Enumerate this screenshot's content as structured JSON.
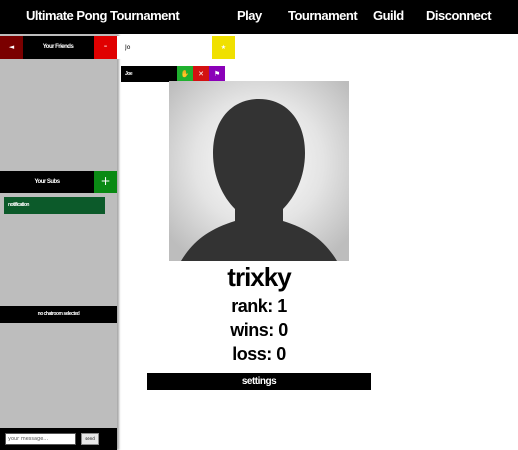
{
  "nav": {
    "title": "Ultimate Pong Tournament",
    "links": [
      "Play",
      "Tournament",
      "Guild",
      "Disconnect"
    ]
  },
  "sidebar": {
    "friends_label": "Your Friends",
    "back_icon": "◄",
    "remove_label": "-",
    "subs_label": "Your Subs",
    "add_label": "+",
    "notification_item": "notification",
    "chat_status": "no chatroom selected",
    "message_placeholder": "your message...",
    "send_label": "send"
  },
  "search": {
    "value": "Jo",
    "go_icon": "★"
  },
  "user_row": {
    "name": "Joe",
    "block_icon": "✋",
    "close_icon": "✕",
    "flag_icon": "⚑"
  },
  "profile": {
    "username": "trixky",
    "rank": "rank: 1",
    "wins": "wins: 0",
    "loss": "loss: 0",
    "settings_label": "settings"
  },
  "colors": {
    "background": "#ffffff",
    "bar": "#000000",
    "sidebar": "#bdbdbd",
    "back": "#7a0000",
    "remove": "#e00000",
    "add": "#0a8a14",
    "notification": "#0c5a2a",
    "search_go": "#f0e000",
    "block": "#1fb02e",
    "close": "#d31111",
    "flag": "#8a00b8"
  }
}
